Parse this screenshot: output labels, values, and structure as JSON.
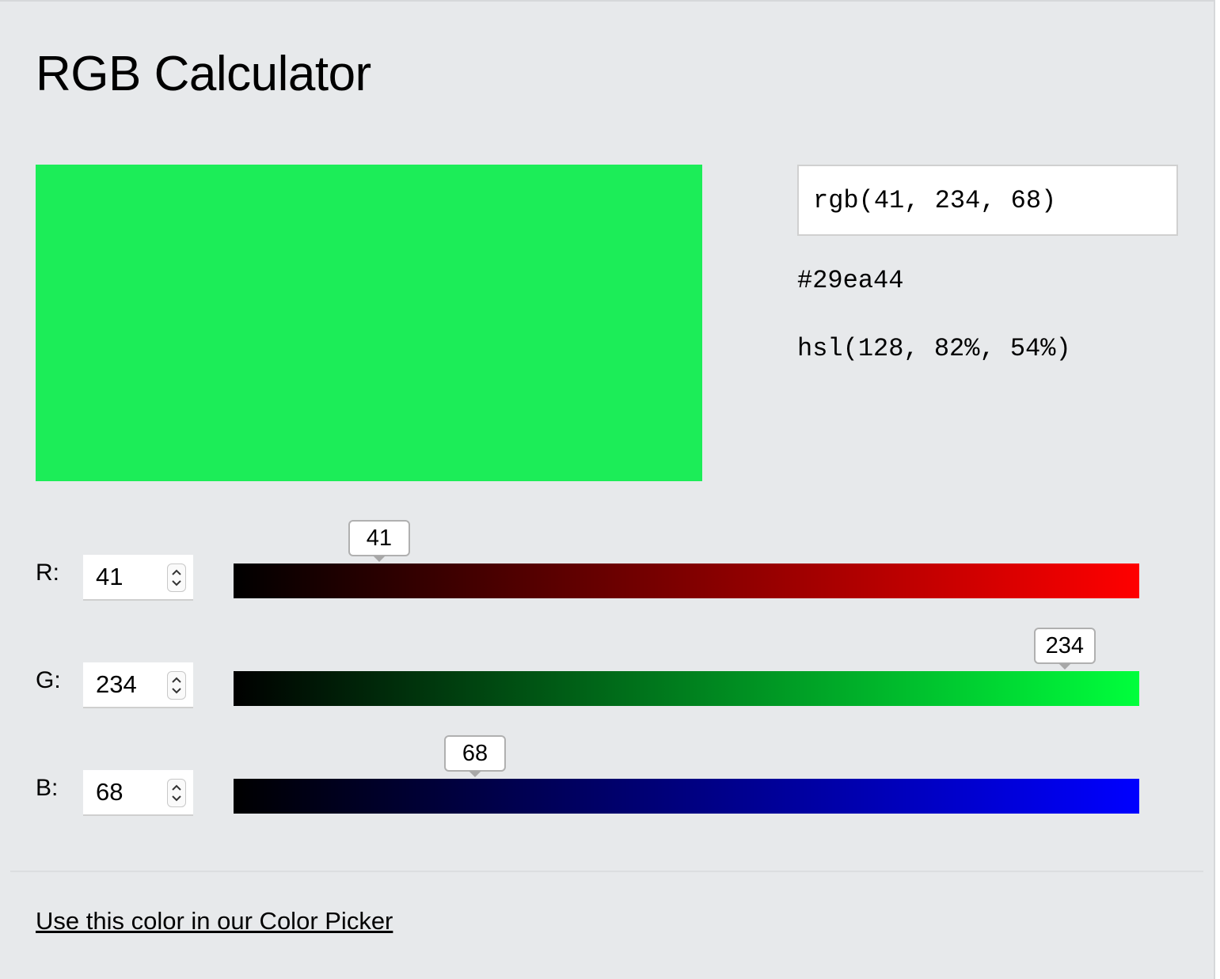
{
  "title": "RGB Calculator",
  "color": {
    "rgb": "rgb(41, 234, 68)",
    "hex": "#29ea44",
    "hsl": "hsl(128, 82%, 54%)",
    "swatch_hex": "#1ced58"
  },
  "channels": [
    {
      "label": "R:",
      "value": 41,
      "value_text": "41",
      "max": 255,
      "end_color": "#ff0000"
    },
    {
      "label": "G:",
      "value": 234,
      "value_text": "234",
      "max": 255,
      "end_color": "#00ff3c"
    },
    {
      "label": "B:",
      "value": 68,
      "value_text": "68",
      "max": 255,
      "end_color": "#0000ff"
    }
  ],
  "link": {
    "label": "Use this color in our Color Picker"
  }
}
